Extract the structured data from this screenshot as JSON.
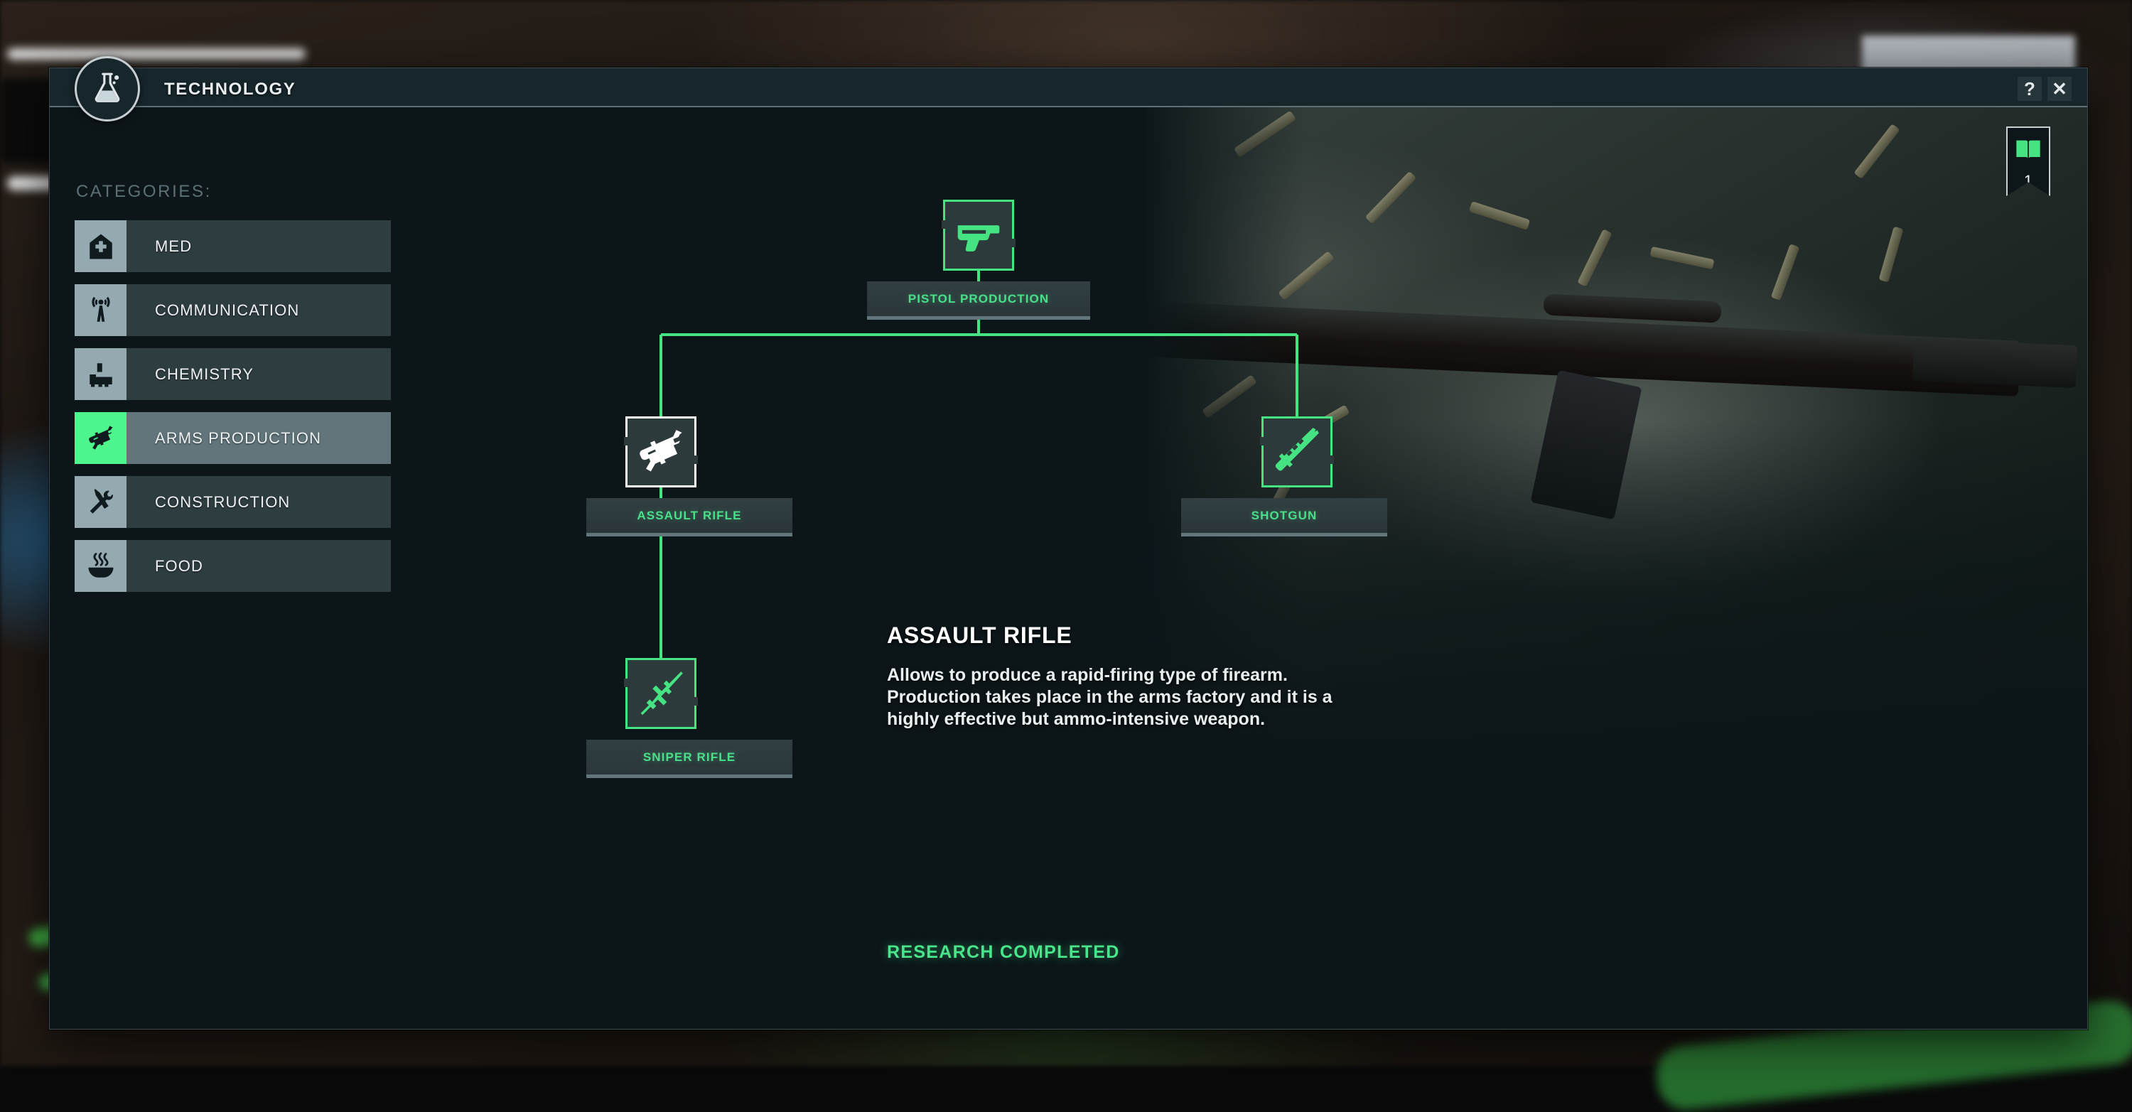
{
  "window": {
    "title": "TECHNOLOGY",
    "icon": "flask-icon",
    "help_label": "?",
    "close_label": "✕"
  },
  "sidebar": {
    "heading": "CATEGORIES:",
    "items": [
      {
        "label": "MED",
        "icon": "hospital-cross-icon",
        "selected": false
      },
      {
        "label": "COMMUNICATION",
        "icon": "radio-tower-icon",
        "selected": false
      },
      {
        "label": "CHEMISTRY",
        "icon": "chemical-factory-icon",
        "selected": false
      },
      {
        "label": "ARMS PRODUCTION",
        "icon": "assault-rifle-icon",
        "selected": true
      },
      {
        "label": "CONSTRUCTION",
        "icon": "hammer-wrench-icon",
        "selected": false
      },
      {
        "label": "FOOD",
        "icon": "soup-bowl-icon",
        "selected": false
      }
    ]
  },
  "bookmark": {
    "icon": "open-book-icon",
    "count": "1"
  },
  "tech_tree": {
    "nodes": [
      {
        "id": "pistol-production",
        "label": "PISTOL PRODUCTION",
        "icon": "pistol-icon",
        "state": "researched",
        "selected": false
      },
      {
        "id": "assault-rifle",
        "label": "ASSAULT RIFLE",
        "icon": "assault-rifle-icon",
        "state": "researched",
        "selected": true
      },
      {
        "id": "shotgun",
        "label": "SHOTGUN",
        "icon": "shotgun-icon",
        "state": "researched",
        "selected": false
      },
      {
        "id": "sniper-rifle",
        "label": "SNIPER RIFLE",
        "icon": "sniper-rifle-icon",
        "state": "researched",
        "selected": false
      }
    ],
    "edges": [
      {
        "from": "pistol-production",
        "to": "assault-rifle"
      },
      {
        "from": "pistol-production",
        "to": "shotgun"
      },
      {
        "from": "assault-rifle",
        "to": "sniper-rifle"
      }
    ]
  },
  "details": {
    "title": "ASSAULT RIFLE",
    "description": "Allows to produce a rapid-firing type of firearm. Production takes place in the arms factory and it is a highly effective but ammo-intensive weapon.",
    "status": "RESEARCH COMPLETED"
  },
  "colors": {
    "accent_green": "#45e382",
    "panel_bg": "#0c1619",
    "titlebar_bg": "#16262b",
    "row_bg": "#2e3d40",
    "row_selected_bg": "#61757a",
    "icon_tile_bg": "#94aab0",
    "icon_tile_selected_bg": "#4df58c"
  }
}
